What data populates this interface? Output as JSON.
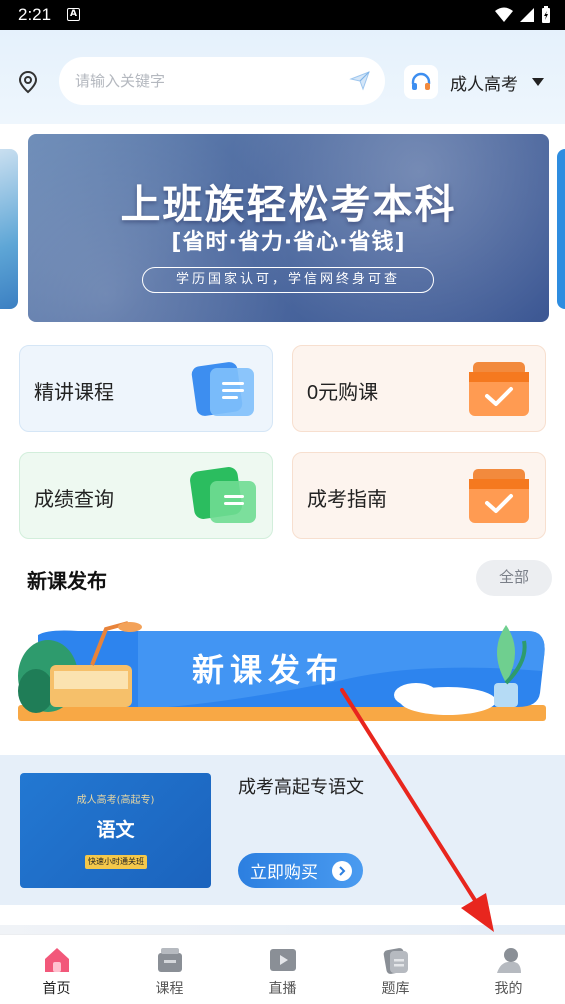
{
  "status_bar": {
    "time": "2:21",
    "notif_letter": "A"
  },
  "header": {
    "search_placeholder": "请输入关键字",
    "exam_type": "成人高考"
  },
  "banner": {
    "title": "上班族轻松考本科",
    "subtitle": "[省时·省力·省心·省钱]",
    "note": "学历国家认可，学信网终身可查"
  },
  "tiles": [
    {
      "label": "精讲课程",
      "icon": "document-icon",
      "color": "#3d8ef0"
    },
    {
      "label": "0元购课",
      "icon": "coupon-check-icon",
      "color": "#f28a3d"
    },
    {
      "label": "成绩查询",
      "icon": "folder-icon",
      "color": "#33c46b"
    },
    {
      "label": "成考指南",
      "icon": "guide-check-icon",
      "color": "#f28a3d"
    }
  ],
  "new_courses": {
    "title": "新课发布",
    "all_label": "全部",
    "promo_text": "新课发布"
  },
  "course": {
    "thumb_top": "成人高考(高起专)",
    "thumb_main": "语文",
    "thumb_tag": "快速小时通关班",
    "name": "成考高起专语文",
    "buy_label": "立即购买"
  },
  "tabbar": [
    {
      "label": "首页",
      "icon": "home-icon",
      "active": true
    },
    {
      "label": "课程",
      "icon": "course-icon",
      "active": false
    },
    {
      "label": "直播",
      "icon": "live-icon",
      "active": false
    },
    {
      "label": "题库",
      "icon": "question-bank-icon",
      "active": false
    },
    {
      "label": "我的",
      "icon": "profile-icon",
      "active": false
    }
  ],
  "colors": {
    "accent": "#2c7fe0",
    "annotation": "#e8261e"
  }
}
